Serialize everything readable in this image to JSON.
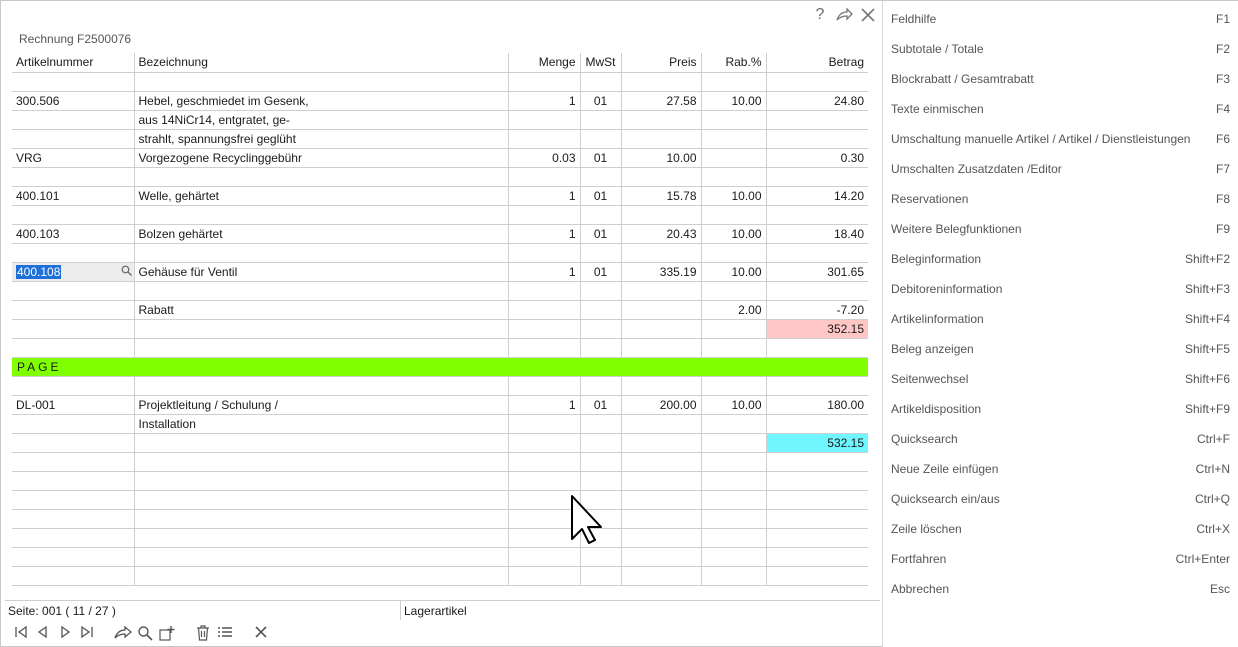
{
  "document": {
    "title": "Rechnung F2500076"
  },
  "icons": {
    "help": "question-icon",
    "forward": "share-arrow-icon",
    "close": "close-icon"
  },
  "table": {
    "headers": {
      "artikelnummer": "Artikelnummer",
      "bezeichnung": "Bezeichnung",
      "menge": "Menge",
      "mwst": "MwSt",
      "preis": "Preis",
      "rabatt": "Rab.%",
      "betrag": "Betrag"
    },
    "rows": [
      {
        "art": "",
        "bez": "",
        "menge": "",
        "mwst": "",
        "preis": "",
        "rab": "",
        "betrag": ""
      },
      {
        "art": "300.506",
        "bez": "Hebel, geschmiedet im Gesenk,",
        "menge": "1",
        "mwst": "01",
        "preis": "27.58",
        "rab": "10.00",
        "betrag": "24.80"
      },
      {
        "art": "",
        "bez": "aus 14NiCr14, entgratet, ge-",
        "menge": "",
        "mwst": "",
        "preis": "",
        "rab": "",
        "betrag": ""
      },
      {
        "art": "",
        "bez": "strahlt, spannungsfrei geglüht",
        "menge": "",
        "mwst": "",
        "preis": "",
        "rab": "",
        "betrag": ""
      },
      {
        "art": "VRG",
        "bez": "Vorgezogene Recyclinggebühr",
        "menge": "0.03",
        "mwst": "01",
        "preis": "10.00",
        "rab": "",
        "betrag": "0.30"
      },
      {
        "art": "",
        "bez": "",
        "menge": "",
        "mwst": "",
        "preis": "",
        "rab": "",
        "betrag": ""
      },
      {
        "art": "400.101",
        "bez": "Welle, gehärtet",
        "menge": "1",
        "mwst": "01",
        "preis": "15.78",
        "rab": "10.00",
        "betrag": "14.20"
      },
      {
        "art": "",
        "bez": "",
        "menge": "",
        "mwst": "",
        "preis": "",
        "rab": "",
        "betrag": ""
      },
      {
        "art": "400.103",
        "bez": "Bolzen gehärtet",
        "menge": "1",
        "mwst": "01",
        "preis": "20.43",
        "rab": "10.00",
        "betrag": "18.40"
      },
      {
        "art": "",
        "bez": "",
        "menge": "",
        "mwst": "",
        "preis": "",
        "rab": "",
        "betrag": ""
      },
      {
        "art": "400.108",
        "bez": "Gehäuse für Ventil",
        "menge": "1",
        "mwst": "01",
        "preis": "335.19",
        "rab": "10.00",
        "betrag": "301.65",
        "editing": true
      },
      {
        "art": "",
        "bez": "",
        "menge": "",
        "mwst": "",
        "preis": "",
        "rab": "",
        "betrag": ""
      },
      {
        "art": "",
        "bez": "Rabatt",
        "menge": "",
        "mwst": "",
        "preis": "",
        "rab": "2.00",
        "betrag": "-7.20"
      },
      {
        "art": "",
        "bez": "",
        "menge": "",
        "mwst": "",
        "preis": "",
        "rab": "",
        "betrag": "352.15",
        "highlight": "pink"
      },
      {
        "art": "",
        "bez": "",
        "menge": "",
        "mwst": "",
        "preis": "",
        "rab": "",
        "betrag": ""
      },
      {
        "page": "PAGE"
      },
      {
        "art": "",
        "bez": "",
        "menge": "",
        "mwst": "",
        "preis": "",
        "rab": "",
        "betrag": ""
      },
      {
        "art": "DL-001",
        "bez": "Projektleitung / Schulung /",
        "menge": "1",
        "mwst": "01",
        "preis": "200.00",
        "rab": "10.00",
        "betrag": "180.00"
      },
      {
        "art": "",
        "bez": "Installation",
        "menge": "",
        "mwst": "",
        "preis": "",
        "rab": "",
        "betrag": ""
      },
      {
        "art": "",
        "bez": "",
        "menge": "",
        "mwst": "",
        "preis": "",
        "rab": "",
        "betrag": "532.15",
        "highlight": "cyan"
      },
      {
        "art": "",
        "bez": "",
        "menge": "",
        "mwst": "",
        "preis": "",
        "rab": "",
        "betrag": ""
      },
      {
        "art": "",
        "bez": "",
        "menge": "",
        "mwst": "",
        "preis": "",
        "rab": "",
        "betrag": ""
      },
      {
        "art": "",
        "bez": "",
        "menge": "",
        "mwst": "",
        "preis": "",
        "rab": "",
        "betrag": ""
      },
      {
        "art": "",
        "bez": "",
        "menge": "",
        "mwst": "",
        "preis": "",
        "rab": "",
        "betrag": ""
      },
      {
        "art": "",
        "bez": "",
        "menge": "",
        "mwst": "",
        "preis": "",
        "rab": "",
        "betrag": ""
      },
      {
        "art": "",
        "bez": "",
        "menge": "",
        "mwst": "",
        "preis": "",
        "rab": "",
        "betrag": ""
      },
      {
        "art": "",
        "bez": "",
        "menge": "",
        "mwst": "",
        "preis": "",
        "rab": "",
        "betrag": ""
      }
    ]
  },
  "status": {
    "page": "Seite: 001   ( 11 / 27 )",
    "type": "Lagerartikel"
  },
  "toolbar": [
    "first-page-icon",
    "prev-page-icon",
    "next-page-icon",
    "last-page-icon",
    "share-icon",
    "search-icon",
    "add-icon",
    "delete-icon",
    "list-icon",
    "close-icon"
  ],
  "panel": {
    "items": [
      {
        "label": "Feldhilfe",
        "key": "F1"
      },
      {
        "label": "Subtotale / Totale",
        "key": "F2"
      },
      {
        "label": "Blockrabatt / Gesamtrabatt",
        "key": "F3"
      },
      {
        "label": "Texte einmischen",
        "key": "F4"
      },
      {
        "label": "Umschaltung manuelle Artikel / Artikel / Dienstleistungen",
        "key": "F6"
      },
      {
        "label": "Umschalten Zusatzdaten /Editor",
        "key": "F7"
      },
      {
        "label": "Reservationen",
        "key": "F8"
      },
      {
        "label": "Weitere Belegfunktionen",
        "key": "F9"
      },
      {
        "label": "Beleginformation",
        "key": "Shift+F2"
      },
      {
        "label": "Debitoreninformation",
        "key": "Shift+F3"
      },
      {
        "label": "Artikelinformation",
        "key": "Shift+F4"
      },
      {
        "label": "Beleg anzeigen",
        "key": "Shift+F5"
      },
      {
        "label": "Seitenwechsel",
        "key": "Shift+F6"
      },
      {
        "label": "Artikeldisposition",
        "key": "Shift+F9"
      },
      {
        "label": "Quicksearch",
        "key": "Ctrl+F"
      },
      {
        "label": "Neue Zeile einfügen",
        "key": "Ctrl+N"
      },
      {
        "label": "Quicksearch ein/aus",
        "key": "Ctrl+Q"
      },
      {
        "label": "Zeile löschen",
        "key": "Ctrl+X"
      },
      {
        "label": "Fortfahren",
        "key": "Ctrl+Enter"
      },
      {
        "label": "Abbrechen",
        "key": "Esc"
      }
    ]
  }
}
